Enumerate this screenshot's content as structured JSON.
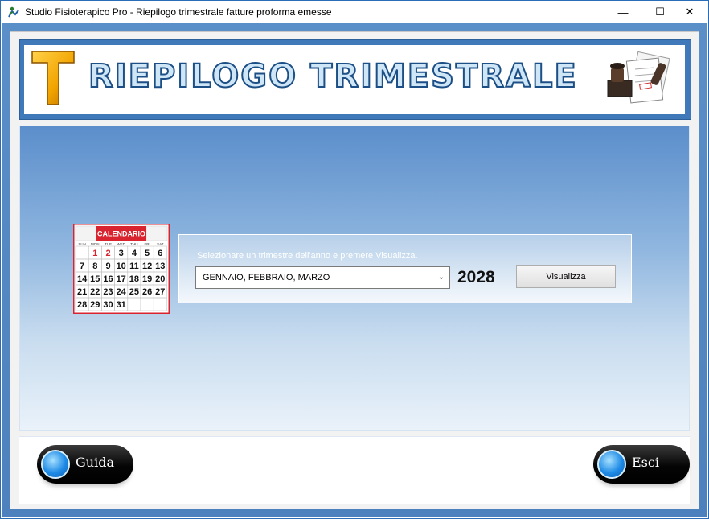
{
  "window": {
    "title": "Studio Fisioterapico Pro - Riepilogo trimestrale fatture proforma emesse",
    "minimize_glyph": "—",
    "maximize_glyph": "☐",
    "close_glyph": "✕"
  },
  "header": {
    "initial": "T",
    "title": "RIEPILOGO TRIMESTRALE"
  },
  "calendar": {
    "heading": "CALENDARIO",
    "weekdays": [
      "SUN",
      "MON",
      "TUE",
      "WED",
      "THU",
      "FRI",
      "SAT"
    ],
    "weeks": [
      [
        "",
        "1",
        "2",
        "3",
        "4",
        "5",
        "6"
      ],
      [
        "7",
        "8",
        "9",
        "10",
        "11",
        "12",
        "13"
      ],
      [
        "14",
        "15",
        "16",
        "17",
        "18",
        "19",
        "20"
      ],
      [
        "21",
        "22",
        "23",
        "24",
        "25",
        "26",
        "27"
      ],
      [
        "28",
        "29",
        "30",
        "31",
        "",
        "",
        ""
      ]
    ]
  },
  "form": {
    "instruction": "Selezionare un trimestre dell'anno e premere Visualizza.",
    "quarter_selected": "GENNAIO, FEBBRAIO, MARZO",
    "year": "2028",
    "view_button": "Visualizza"
  },
  "footer": {
    "help_button": "Guida",
    "exit_button": "Esci"
  },
  "colors": {
    "frame_blue": "#4d81bd",
    "header_title_outline": "#1c4f86",
    "calendar_red": "#d9232e",
    "orb_blue": "#1f8be6"
  }
}
